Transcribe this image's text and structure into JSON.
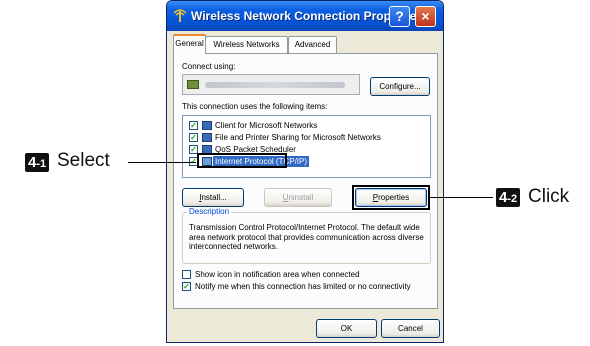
{
  "window": {
    "title": "Wireless Network Connection Properties",
    "help_btn": "?",
    "close_btn": "×"
  },
  "tabs": [
    {
      "label": "General",
      "active": true
    },
    {
      "label": "Wireless Networks",
      "active": false
    },
    {
      "label": "Advanced",
      "active": false
    }
  ],
  "general": {
    "connect_using_label": "Connect using:",
    "adapter_name_visible": false,
    "configure_button": "Configure...",
    "items_label": "This connection uses the following items:",
    "items": [
      {
        "label": "Client for Microsoft Networks",
        "checked": true,
        "icon": "network-client-icon",
        "selected": false
      },
      {
        "label": "File and Printer Sharing for Microsoft Networks",
        "checked": true,
        "icon": "file-printer-sharing-icon",
        "selected": false
      },
      {
        "label": "QoS Packet Scheduler",
        "checked": true,
        "icon": "qos-scheduler-icon",
        "selected": false
      },
      {
        "label": "Internet Protocol (TCP/IP)",
        "checked": true,
        "icon": "protocol-icon",
        "selected": true
      }
    ],
    "install_button": "Install...",
    "uninstall_button": "Uninstall",
    "properties_button": "Properties",
    "description_legend": "Description",
    "description_text": "Transmission Control Protocol/Internet Protocol. The default wide area network protocol that provides communication across diverse interconnected networks.",
    "show_icon_label": "Show icon in notification area when connected",
    "show_icon_checked": false,
    "notify_label": "Notify me when this connection has limited or no connectivity",
    "notify_checked": true,
    "ok_button": "OK",
    "cancel_button": "Cancel"
  },
  "annotations": {
    "step1_num": "4",
    "step1_sub": "-1",
    "step1_text": "Select",
    "step2_num": "4",
    "step2_sub": "-2",
    "step2_text": "Click"
  },
  "colors": {
    "titlebar": "#0754d6",
    "selection": "#316ac5",
    "dialog_bg": "#ece9d8",
    "tab_accent": "#e68b2c"
  }
}
